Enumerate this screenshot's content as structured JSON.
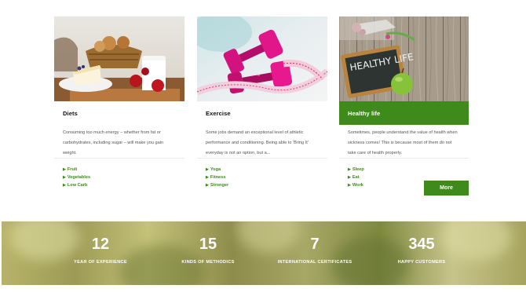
{
  "cards": [
    {
      "title": "Diets",
      "description": "Consuming too much energy – whether from fat or carbohydrates, including sugar – will make you gain weight.",
      "tags": [
        "Fruit",
        "Vegetables",
        "Low Carb"
      ],
      "image": "diet-food-photo"
    },
    {
      "title": "Exercise",
      "description": "Some jobs demand an exceptional level of athletic performance and conditioning. Being able to 'Bring It' everyday is not an option, but a...",
      "tags": [
        "Yoga",
        "Fitness",
        "Stronger"
      ],
      "image": "dumbbells-photo"
    },
    {
      "title": "Healthy life",
      "description": "Sometimes, people understand the value of health when sickness comes! This is because most of them do not take care of health properly.",
      "tags": [
        "Sleep",
        "Eat",
        "Work"
      ],
      "image": "healthy-life-chalkboard-photo",
      "chalkboard_text": "HEALTHY LIFE"
    }
  ],
  "more_button": {
    "label": "More"
  },
  "stats": [
    {
      "number": "12",
      "label": "YEAR OF EXPERIENCE"
    },
    {
      "number": "15",
      "label": "KINDS OF METHODICS"
    },
    {
      "number": "7",
      "label": "INTERNATIONAL CERTIFICATES"
    },
    {
      "number": "345",
      "label": "HAPPY CUSTOMERS"
    }
  ],
  "colors": {
    "accent": "#3e8b1c",
    "text": "#555555",
    "heading": "#111111"
  }
}
